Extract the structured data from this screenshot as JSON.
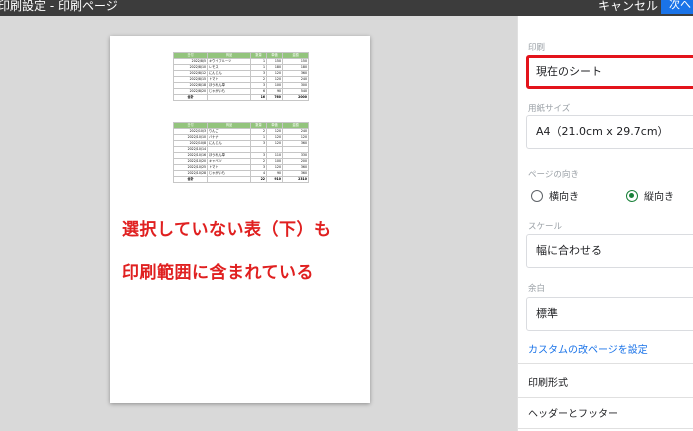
{
  "topbar": {
    "title": "印刷設定 - 印刷ページ",
    "cancel_label": "キャンセル",
    "next_label": "次へ"
  },
  "preview": {
    "table1": {
      "headers": [
        "日付",
        "商品",
        "数量",
        "単価",
        "金額"
      ],
      "rows": [
        [
          "2022/8/5",
          "キウイフルーツ",
          "1",
          "150",
          "150"
        ],
        [
          "2022/8/10",
          "レモス",
          "1",
          "180",
          "180"
        ],
        [
          "2022/8/12",
          "にんじん",
          "3",
          "120",
          "360"
        ],
        [
          "2022/8/15",
          "トマト",
          "2",
          "120",
          "240"
        ],
        [
          "2022/8/18",
          "ほうれん草",
          "3",
          "100",
          "300"
        ],
        [
          "2022/8/20",
          "じゃがいも",
          "6",
          "90",
          "540"
        ]
      ],
      "total": [
        "合計",
        "",
        "16",
        "760",
        "2000"
      ]
    },
    "table2": {
      "headers": [
        "日付",
        "商品",
        "数量",
        "単価",
        "金額"
      ],
      "rows": [
        [
          "2022/10/3",
          "りんご",
          "2",
          "120",
          "240"
        ],
        [
          "2022/10/10",
          "バナナ",
          "1",
          "120",
          "120"
        ],
        [
          "2022/10/8",
          "にんじん",
          "3",
          "120",
          "360"
        ],
        [
          "2022/10/14",
          "",
          "",
          "",
          ""
        ],
        [
          "2022/10/16",
          "ほうれん草",
          "3",
          "110",
          "330"
        ],
        [
          "2022/10/20",
          "キャベツ",
          "2",
          "100",
          "200"
        ],
        [
          "2022/10/25",
          "トマト",
          "3",
          "120",
          "360"
        ],
        [
          "2022/10/28",
          "じゃがいも",
          "4",
          "90",
          "360"
        ]
      ],
      "total": [
        "合計",
        "",
        "22",
        "910",
        "2310"
      ]
    },
    "annotation_line1": "選択していない表（下）も",
    "annotation_line2": "印刷範囲に含まれている"
  },
  "panel": {
    "print_label": "印刷",
    "print_value": "現在のシート",
    "paper_label": "用紙サイズ",
    "paper_value": "A4（21.0cm x 29.7cm）",
    "orientation_label": "ページの向き",
    "orientation_landscape": "横向き",
    "orientation_portrait": "縦向き",
    "orientation_selected": "portrait",
    "scale_label": "スケール",
    "scale_value": "幅に合わせる",
    "margin_label": "余白",
    "margin_value": "標準",
    "custom_break_link": "カスタムの改ページを設定",
    "format_section": "印刷形式",
    "header_footer_section": "ヘッダーとフッター"
  },
  "colors": {
    "accent": "#1a73e8",
    "highlight": "#e3131b",
    "annotation": "#e02020",
    "table_header": "#93c47d",
    "radio_checked": "#188038"
  }
}
